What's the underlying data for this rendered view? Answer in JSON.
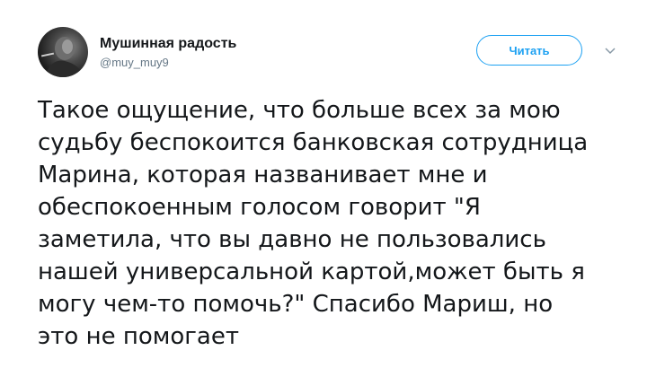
{
  "author": {
    "display_name": "Мушинная радость",
    "handle": "@muy_muy9"
  },
  "actions": {
    "follow_label": "Читать",
    "menu_icon": "chevron-down-icon"
  },
  "tweet": {
    "lines": [
      "Такое ощущение, что больше всех за мою",
      "судьбу беспокоится банковская сотрудница",
      "Марина, которая названивает мне и",
      "обеспокоенным голосом говорит \"Я",
      "заметила, что вы давно не пользовались",
      "нашей универсальной картой,может быть я",
      "могу чем-то помочь?\" Спасибо Мариш, но",
      "это не помогает"
    ]
  },
  "colors": {
    "accent": "#1da1f2",
    "secondary_text": "#657786",
    "primary_text": "#14171a"
  }
}
